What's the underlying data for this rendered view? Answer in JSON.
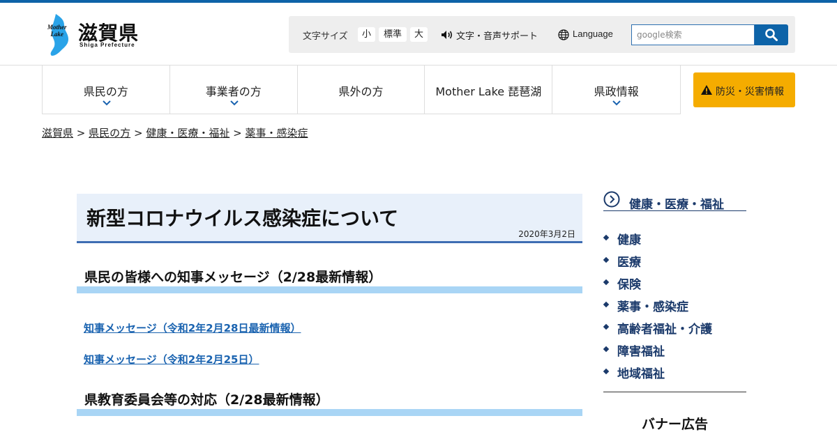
{
  "header": {
    "logo_title": "滋賀県",
    "logo_subtitle": "Shiga Prefecture",
    "logo_mark_line1": "Mother",
    "logo_mark_line2": "Lake",
    "brand_color": "#0d63a8",
    "text_size_label": "文字サイズ",
    "text_size_options": [
      "小",
      "標準",
      "大"
    ],
    "speech_support": "文字・音声サポート",
    "language": "Language",
    "search_placeholder": "google検索",
    "search_icon": "search-icon"
  },
  "nav": {
    "items": [
      {
        "label": "県民の方",
        "has_dropdown": true
      },
      {
        "label": "事業者の方",
        "has_dropdown": true
      },
      {
        "label": "県外の方",
        "has_dropdown": false
      },
      {
        "label": "Mother Lake 琵琶湖",
        "has_dropdown": false
      },
      {
        "label": "県政情報",
        "has_dropdown": true
      }
    ],
    "disaster_label": "防災・災害情報",
    "disaster_color": "#f5ac00"
  },
  "breadcrumb": {
    "items": [
      "滋賀県",
      "県民の方",
      "健康・医療・福祉",
      "薬事・感染症"
    ],
    "separator": ">"
  },
  "main": {
    "title": "新型コロナウイルス感染症について",
    "date": "2020年3月2日",
    "sections": [
      {
        "heading": "県民の皆様への知事メッセージ（2/28最新情報）",
        "links": [
          "知事メッセージ（令和2年2月28日最新情報）",
          "知事メッセージ（令和2年2月25日）"
        ]
      },
      {
        "heading": "県教育委員会等の対応（2/28最新情報）",
        "links": []
      }
    ]
  },
  "sidebar": {
    "title": "健康・医療・福祉",
    "items": [
      "健康",
      "医療",
      "保険",
      "薬事・感染症",
      "高齢者福祉・介護",
      "障害福祉",
      "地域福祉"
    ],
    "banner_title": "バナー広告"
  }
}
